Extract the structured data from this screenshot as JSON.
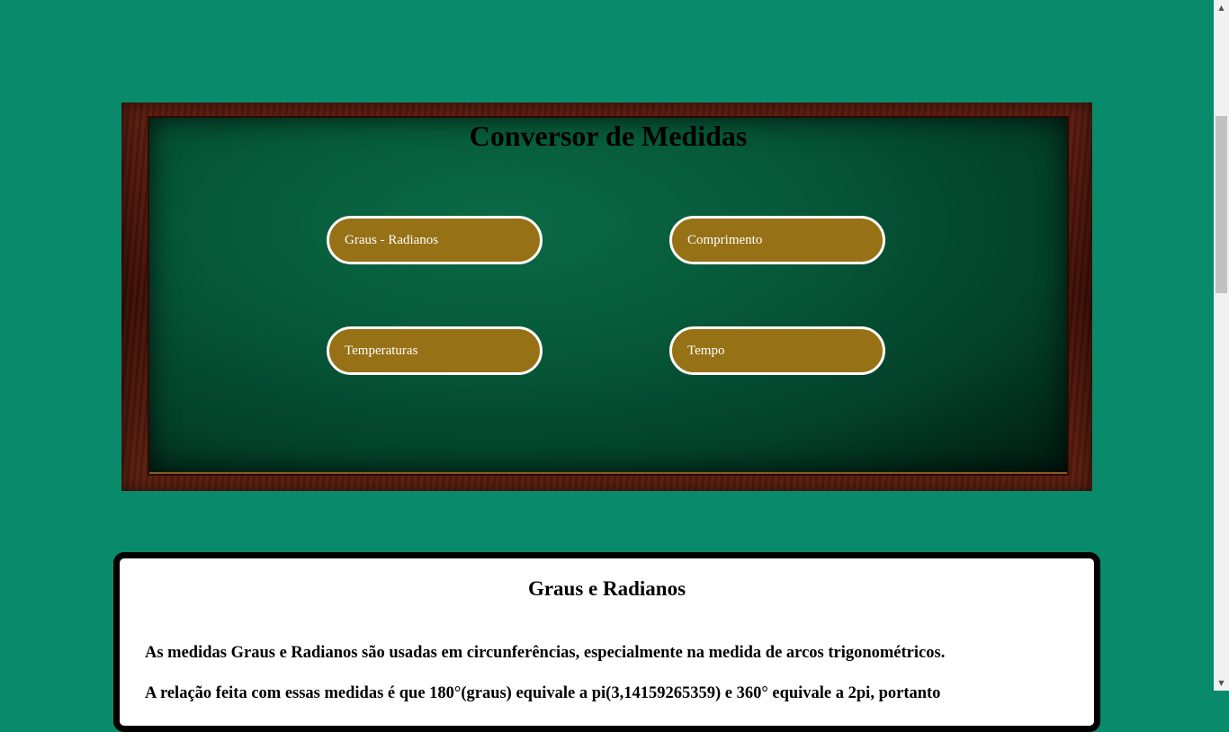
{
  "board": {
    "title": "Conversor de Medidas",
    "buttons": [
      {
        "label": "Graus - Radianos"
      },
      {
        "label": "Comprimento"
      },
      {
        "label": "Temperaturas"
      },
      {
        "label": "Tempo"
      }
    ]
  },
  "info": {
    "title": "Graus e Radianos",
    "paragraphs": [
      "As medidas Graus e Radianos são usadas em circunferências, especialmente na medida de arcos trigonométricos.",
      "A relação feita com essas medidas é que 180°(graus) equivale a pi(3,14159265359) e 360° equivale a 2pi, portanto"
    ]
  },
  "scrollbar": {
    "up_icon": "▲",
    "down_icon": "▼"
  },
  "colors": {
    "page_background": "#098b6b",
    "button_fill": "#977115",
    "button_border": "#ffffff",
    "board_green": "#065a39",
    "frame_wood": "#4a1509"
  }
}
